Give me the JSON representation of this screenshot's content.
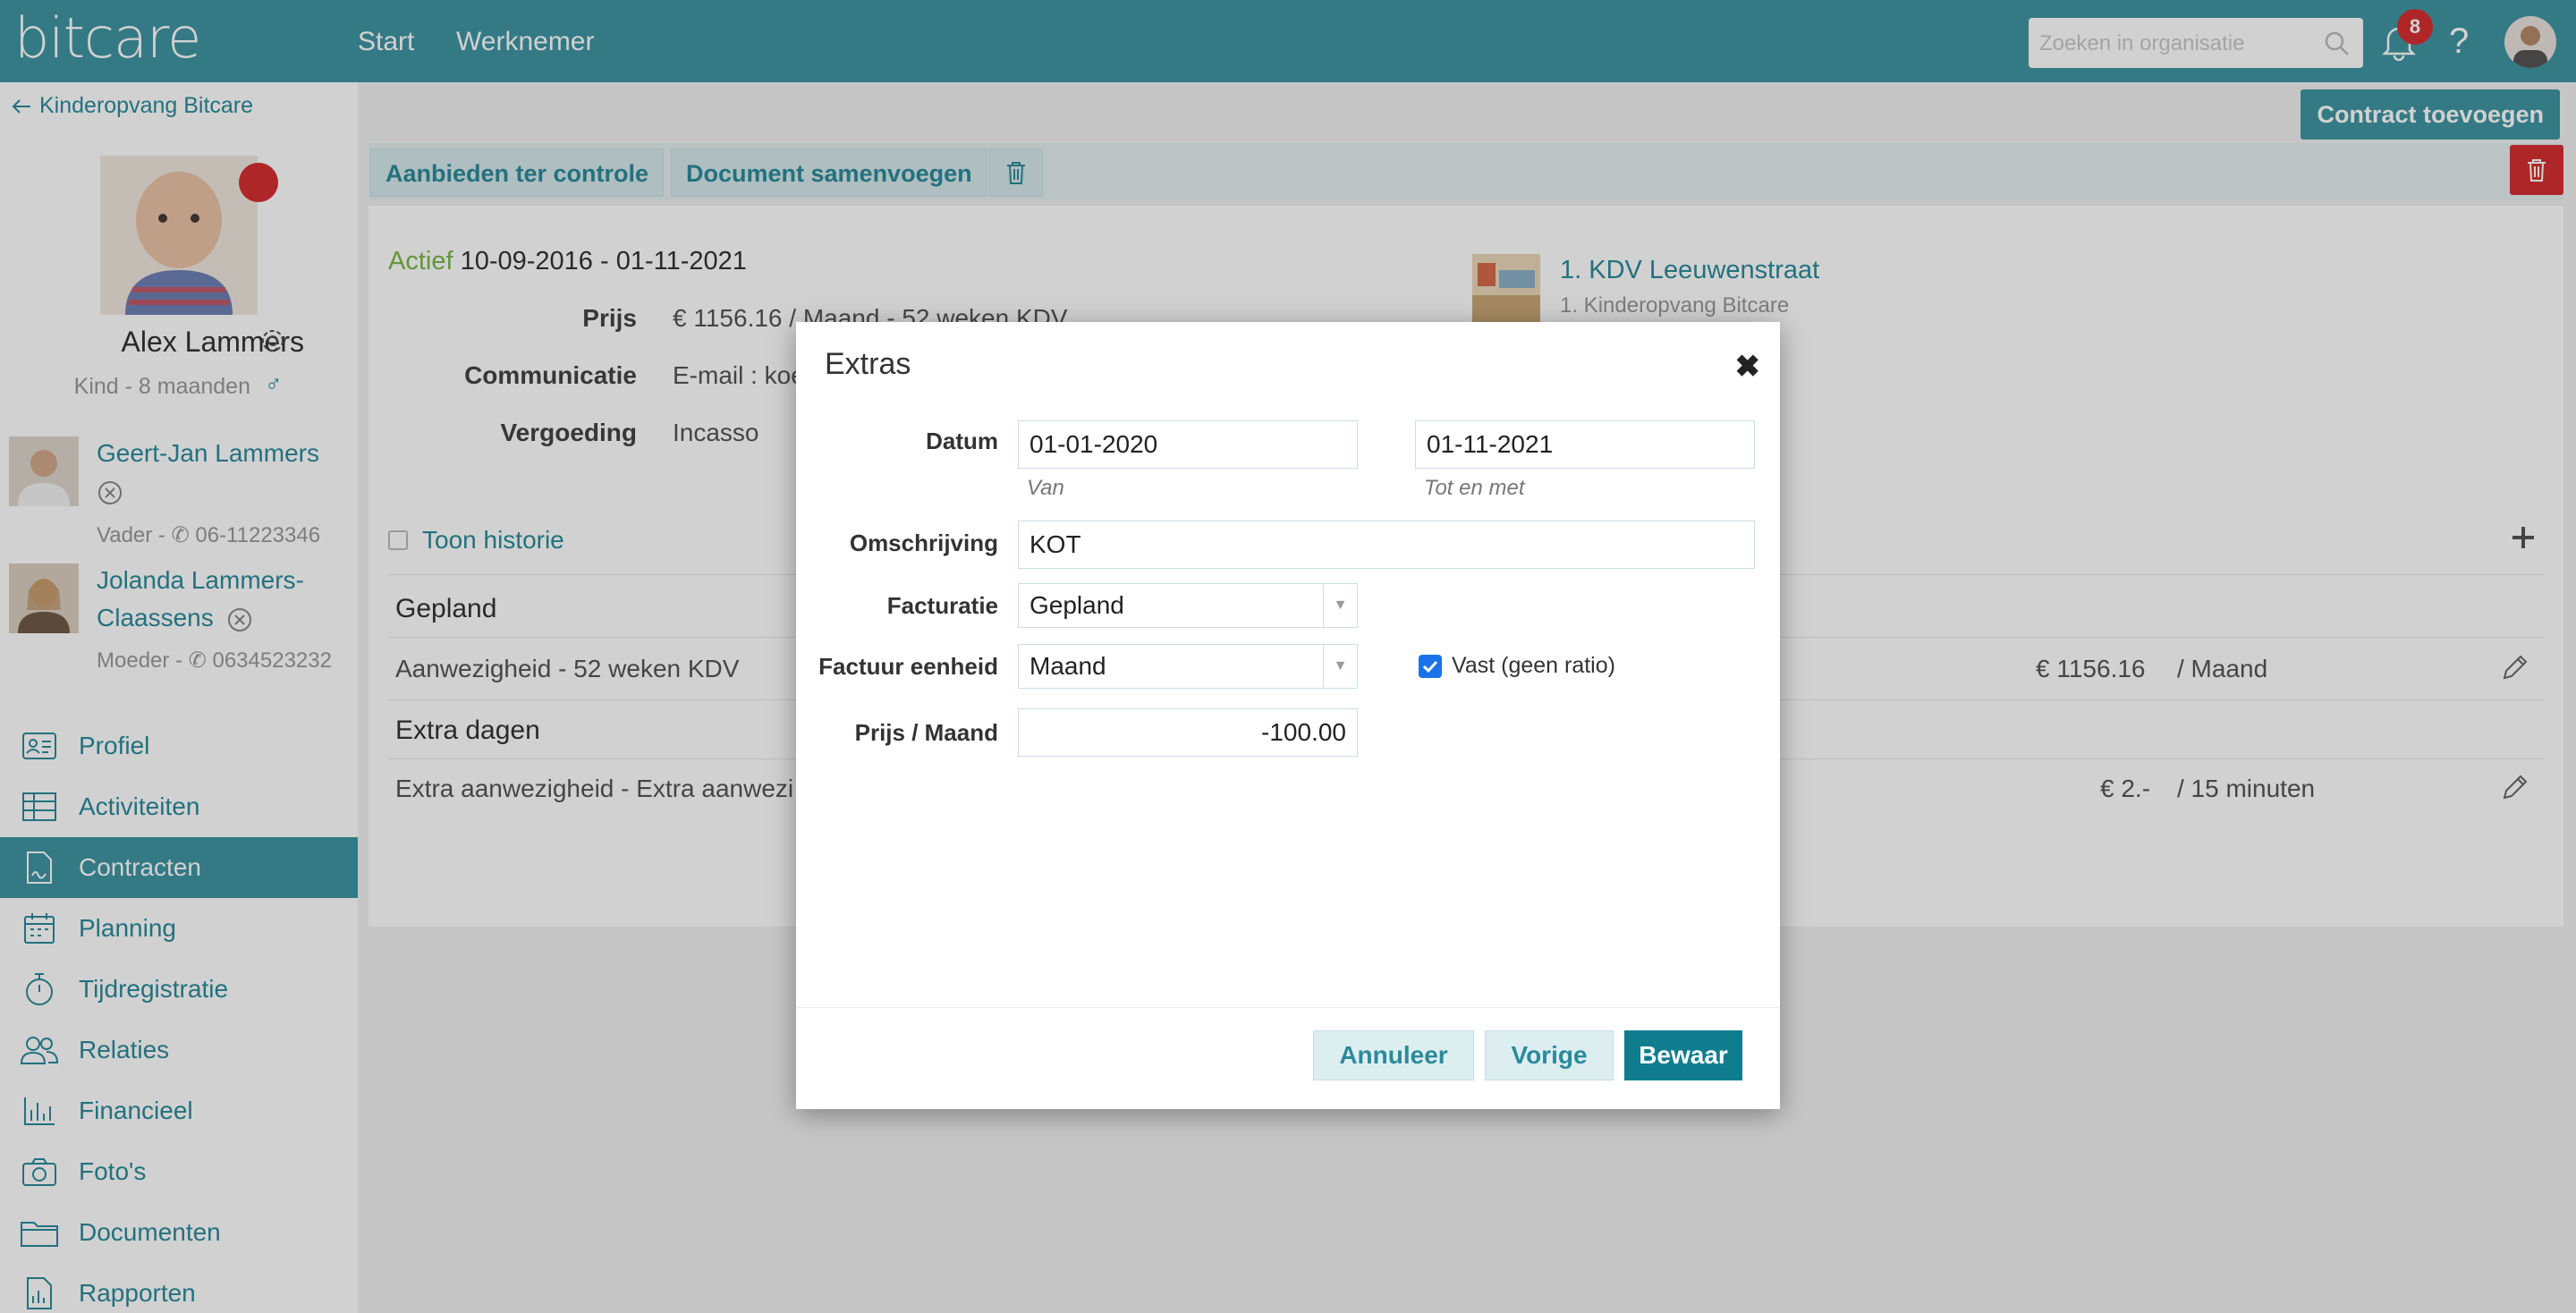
{
  "app": {
    "logo": "bitcare",
    "nav": [
      "Start",
      "Werknemer"
    ],
    "search_placeholder": "Zoeken in organisatie",
    "notification_count": "8",
    "help": "?"
  },
  "sidebar": {
    "back_label": "Kinderopvang Bitcare",
    "child": {
      "name": "Alex Lammers",
      "subtitle": "Kind - 8 maanden",
      "gender_symbol": "♂"
    },
    "relations": [
      {
        "name": "Geert-Jan Lammers",
        "subtitle": "Vader - ✆ 06-11223346"
      },
      {
        "name_line1": "Jolanda Lammers-",
        "name_line2": "Claassens",
        "subtitle": "Moeder - ✆ 0634523232"
      }
    ],
    "menu": [
      {
        "label": "Profiel",
        "icon": "profile-card-icon"
      },
      {
        "label": "Activiteiten",
        "icon": "table-icon"
      },
      {
        "label": "Contracten",
        "icon": "contract-icon",
        "active": true
      },
      {
        "label": "Planning",
        "icon": "calendar-icon"
      },
      {
        "label": "Tijdregistratie",
        "icon": "stopwatch-icon"
      },
      {
        "label": "Relaties",
        "icon": "people-icon"
      },
      {
        "label": "Financieel",
        "icon": "bar-chart-icon"
      },
      {
        "label": "Foto's",
        "icon": "camera-icon"
      },
      {
        "label": "Documenten",
        "icon": "folder-icon"
      },
      {
        "label": "Rapporten",
        "icon": "report-icon"
      }
    ]
  },
  "main": {
    "add_contract": "Contract toevoegen",
    "toolbar": {
      "review": "Aanbieden ter controle",
      "merge": "Document samenvoegen"
    },
    "contract": {
      "status": "Actief",
      "period": "10-09-2016 - 01-11-2021",
      "fields": [
        {
          "label": "Prijs",
          "value": "€ 1156.16 / Maand - 52 weken KDV"
        },
        {
          "label": "Communicatie",
          "value": "E-mail : koe"
        },
        {
          "label": "Vergoeding",
          "value": "Incasso"
        }
      ],
      "location": {
        "title": "1. KDV Leeuwenstraat",
        "subtitle": "1. Kinderopvang Bitcare"
      }
    },
    "history_label": "Toon historie",
    "sections": [
      {
        "title": "Gepland",
        "row": "Aanwezigheid - 52 weken KDV",
        "amount": "€ 1156.16",
        "unit": "/ Maand"
      },
      {
        "title": "Extra dagen",
        "row": "Extra aanwezigheid - Extra aanwezi",
        "amount": "€ 2.-",
        "unit": "/ 15 minuten"
      }
    ]
  },
  "modal": {
    "title": "Extras",
    "close": "✖",
    "datum_label": "Datum",
    "date_from": "01-01-2020",
    "date_from_hint": "Van",
    "date_to": "01-11-2021",
    "date_to_hint": "Tot en met",
    "description_label": "Omschrijving",
    "description": "KOT",
    "billing_label": "Facturatie",
    "billing": "Gepland",
    "invoice_unit_label": "Factuur eenheid",
    "invoice_unit": "Maand",
    "fixed_label": "Vast (geen ratio)",
    "fixed_checked": true,
    "price_label": "Prijs / Maand",
    "price": "-100.00",
    "buttons": {
      "cancel": "Annuleer",
      "previous": "Vorige",
      "save": "Bewaar"
    }
  },
  "colors": {
    "brand": "#3f95a3",
    "link": "#2b8a9a",
    "danger": "#d62f32",
    "active_status": "#7ab648",
    "primary_button": "#0f7d8e"
  }
}
